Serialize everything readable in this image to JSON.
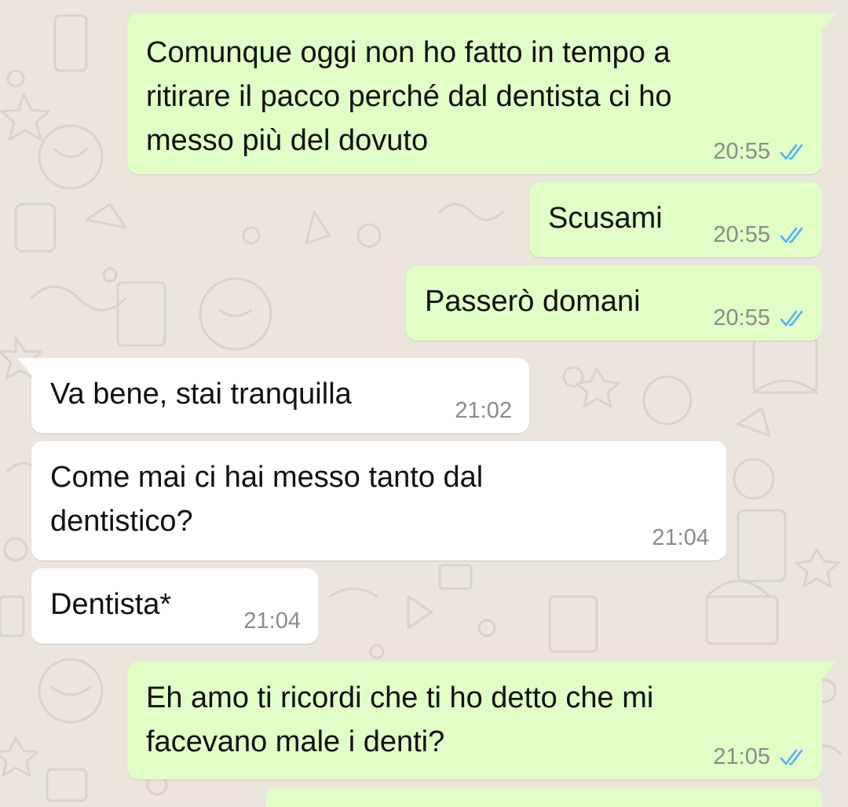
{
  "theme": {
    "outgoing_bubble": "#e1fec6",
    "incoming_bubble": "#ffffff",
    "read_receipt": "#4fb3f6",
    "wallpaper": "#ebe5de"
  },
  "messages": [
    {
      "direction": "outgoing",
      "text": "Comunque oggi non ho fatto in tempo a\nritirare il pacco perché dal dentista ci ho\nmesso più del dovuto",
      "time": "20:55",
      "status_icon": "double-check-read-icon"
    },
    {
      "direction": "outgoing",
      "text": "Scusami",
      "time": "20:55",
      "status_icon": "double-check-read-icon"
    },
    {
      "direction": "outgoing",
      "text": "Passerò domani",
      "time": "20:55",
      "status_icon": "double-check-read-icon"
    },
    {
      "direction": "incoming",
      "text": "Va bene, stai tranquilla",
      "time": "21:02"
    },
    {
      "direction": "incoming",
      "text": "Come mai ci hai messo tanto dal\ndentistico?",
      "time": "21:04"
    },
    {
      "direction": "incoming",
      "text": "Dentista*",
      "time": "21:04"
    },
    {
      "direction": "outgoing",
      "text": "Eh amo ti ricordi che ti ho detto che mi\nfacevano male i denti?",
      "time": "21:05",
      "status_icon": "double-check-read-icon"
    }
  ]
}
